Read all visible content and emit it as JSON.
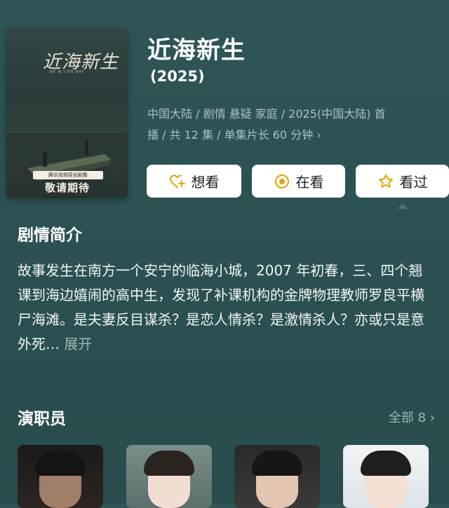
{
  "poster": {
    "title": "近海新生",
    "subtitle": "NE W LIFE BAY",
    "tag_small": "腾讯视频原创剧集",
    "tag_main": "敬请期待"
  },
  "show": {
    "title": "近海新生",
    "year": "(2025)",
    "meta_line1": "中国大陆 / 剧情 悬疑 家庭 / 2025(中国大陆) 首",
    "meta_line2": "播 / 共 12 集 / 单集片长 60 分钟",
    "meta_chevron": "›"
  },
  "actions": {
    "want": "想看",
    "watching": "在看",
    "watched": "看过"
  },
  "intro": {
    "heading": "剧情简介",
    "text": "故事发生在南方一个安宁的临海小城，2007 年初春，三、四个翘课到海边嬉闹的高中生，发现了补课机构的金牌物理教师罗良平横尸海滩。是夫妻反目谋杀？是恋人情杀？是激情杀人？亦或只是意外死…",
    "more": "展开"
  },
  "cast": {
    "heading": "演职员",
    "all_label": "全部 8 ›"
  },
  "colors": {
    "background": "#2c5152",
    "muted_text": "#a9c2c1",
    "button_bg": "#ffffff",
    "accent_yellow": "#e5a400"
  },
  "icons": {
    "want": "heart-plus-icon",
    "watching": "target-circle-icon",
    "watched": "star-icon"
  }
}
